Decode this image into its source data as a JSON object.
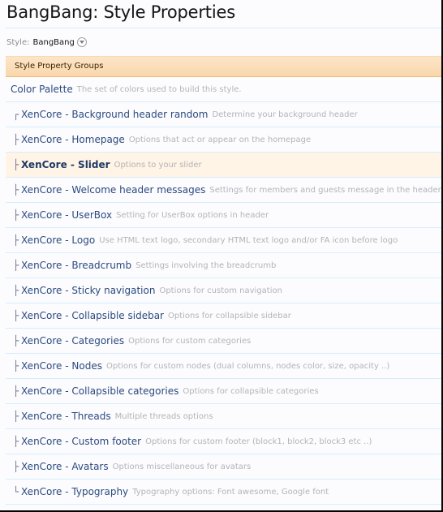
{
  "page": {
    "title": "BangBang: Style Properties"
  },
  "style_chooser": {
    "label": "Style:",
    "value": "BangBang",
    "icon": "chevron-down-circle-icon"
  },
  "section": {
    "header": "Style Property Groups"
  },
  "groups": [
    {
      "branch": "",
      "name": "Color Palette",
      "description": "The set of colors used to build this style.",
      "selected": false
    },
    {
      "branch": "┌",
      "name": "XenCore - Background header random",
      "description": "Determine your background header",
      "selected": false
    },
    {
      "branch": "├",
      "name": "XenCore - Homepage",
      "description": "Options that act or appear on the homepage",
      "selected": false
    },
    {
      "branch": "├",
      "name": "XenCore - Slider",
      "description": "Options to your slider",
      "selected": true
    },
    {
      "branch": "├",
      "name": "XenCore - Welcome header messages",
      "description": "Settings for members and guests message in the header",
      "selected": false
    },
    {
      "branch": "├",
      "name": "XenCore - UserBox",
      "description": "Setting for UserBox options in header",
      "selected": false
    },
    {
      "branch": "├",
      "name": "XenCore - Logo",
      "description": "Use HTML text logo, secondary HTML text logo and/or FA icon before logo",
      "selected": false
    },
    {
      "branch": "├",
      "name": "XenCore - Breadcrumb",
      "description": "Settings involving the breadcrumb",
      "selected": false
    },
    {
      "branch": "├",
      "name": "XenCore - Sticky navigation",
      "description": "Options for custom navigation",
      "selected": false
    },
    {
      "branch": "├",
      "name": "XenCore - Collapsible sidebar",
      "description": "Options for collapsible sidebar",
      "selected": false
    },
    {
      "branch": "├",
      "name": "XenCore - Categories",
      "description": "Options for custom categories",
      "selected": false
    },
    {
      "branch": "├",
      "name": "XenCore - Nodes",
      "description": "Options for custom nodes (dual columns, nodes color, size, opacity ..)",
      "selected": false
    },
    {
      "branch": "├",
      "name": "XenCore - Collapsible categories",
      "description": "Options for collapsible categories",
      "selected": false
    },
    {
      "branch": "├",
      "name": "XenCore - Threads",
      "description": "Multiple threads options",
      "selected": false
    },
    {
      "branch": "├",
      "name": "XenCore - Custom footer",
      "description": "Options for custom footer (block1, block2, block3 etc ..)",
      "selected": false
    },
    {
      "branch": "├",
      "name": "XenCore - Avatars",
      "description": "Options miscellaneous for avatars",
      "selected": false
    },
    {
      "branch": "└",
      "name": "XenCore - Typography",
      "description": "Typography options: Font awesome, Google font",
      "selected": false
    }
  ],
  "colors": {
    "link": "#2b4a7e",
    "description": "#b4b4b8",
    "header_bg": "#fde5c8",
    "selected_row_bg": "#fff4e5",
    "row_border": "#d7edfc"
  }
}
